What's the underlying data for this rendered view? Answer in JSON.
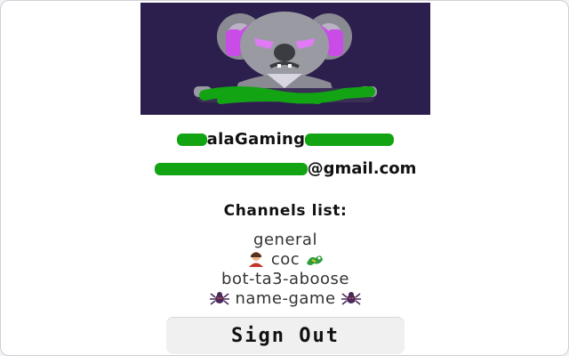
{
  "profile": {
    "avatar_name": "koala-gaming-avatar",
    "username_visible": "alaGaming",
    "email_domain": "@gmail.com",
    "redaction_color": "#12a412"
  },
  "channels": {
    "title": "Channels list:",
    "items": [
      {
        "label": "general",
        "left_icon": "",
        "right_icon": ""
      },
      {
        "label": "coc",
        "left_icon": "person-emoji-icon",
        "right_icon": "dragon-emoji-icon"
      },
      {
        "label": "bot-ta3-aboose",
        "left_icon": "",
        "right_icon": ""
      },
      {
        "label": "name-game",
        "left_icon": "spider-emoji-icon",
        "right_icon": "spider-emoji-icon"
      }
    ]
  },
  "actions": {
    "signout_label": "Sign Out"
  },
  "colors": {
    "avatar_bg": "#2d1f4d",
    "accent_purple": "#c94ce6",
    "button_bg": "#f0f0f0"
  }
}
